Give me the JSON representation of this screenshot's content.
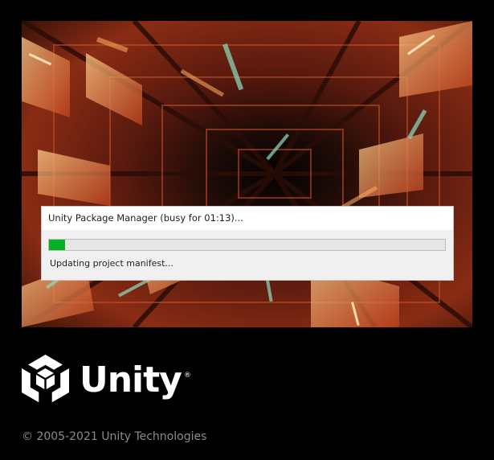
{
  "dialog": {
    "title": "Unity Package Manager (busy for 01:13)...",
    "progress_fraction": 0.04,
    "status": "Updating project manifest..."
  },
  "brand": {
    "logo_icon": "unity-cube-logo-icon",
    "wordmark": "Unity",
    "registered_mark": "®"
  },
  "footer": {
    "copyright": "© 2005-2021 Unity Technologies"
  },
  "colors": {
    "background": "#000000",
    "progress_fill": "#06b025",
    "dialog_bg": "#f0f0f0",
    "wordmark": "#ffffff",
    "copyright": "#8c8c8c"
  }
}
